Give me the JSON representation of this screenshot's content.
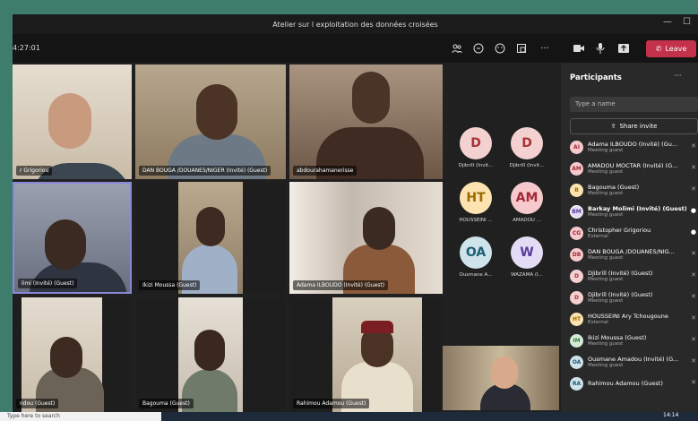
{
  "window": {
    "title": "Atelier sur l exploitation des données croisées",
    "minimize": "—",
    "maximize": "☐"
  },
  "toolbar": {
    "timer": "4:27:01",
    "leave_label": "Leave"
  },
  "tiles": {
    "t1": "r Grigoriou",
    "t2": "DAN BOUGA /DOUANES/NIGER (Invité) (Guest)",
    "t3": "abdourahamanerisse",
    "t4": "limi (Invité) (Guest)",
    "t5": "Ikizi Moussa (Guest)",
    "t6": "Adama ILBOUDO (Invité) (Guest)",
    "t7": "ndou (Guest)",
    "t8": "Bagouma (Guest)",
    "t9": "Rahimou Adamou (Guest)"
  },
  "avatars": [
    {
      "initials": "D",
      "label": "Djibrill (Invit...",
      "bg": "#f3d1d1",
      "fg": "#a33"
    },
    {
      "initials": "D",
      "label": "Djibrill (Invit...",
      "bg": "#f3d1d1",
      "fg": "#a33"
    },
    {
      "initials": "HT",
      "label": "HOUSSEINI ...",
      "bg": "#fce3b0",
      "fg": "#9a6b00"
    },
    {
      "initials": "AM",
      "label": "AMADOU ...",
      "bg": "#f6c9cc",
      "fg": "#a32838"
    },
    {
      "initials": "OA",
      "label": "Ousmane A...",
      "bg": "#cfe3ea",
      "fg": "#1f5d74"
    },
    {
      "initials": "W",
      "label": "WAZAMA (I...",
      "bg": "#e3dcf4",
      "fg": "#5a3a9e"
    }
  ],
  "panel": {
    "title": "Participants",
    "more": "···",
    "search_placeholder": "Type a name",
    "share_label": "Share invite"
  },
  "participants": [
    {
      "initials": "AI",
      "name": "Adama ILBOUDO (Invité) (Gu...",
      "role": "Meeting guest",
      "bg": "#f6c9cc",
      "fg": "#a32838"
    },
    {
      "initials": "AM",
      "name": "AMADOU MOCTAR (Invité) (G...",
      "role": "Meeting guest",
      "bg": "#f6c9cc",
      "fg": "#a32838"
    },
    {
      "initials": "B",
      "name": "Bagouma (Guest)",
      "role": "Meeting guest",
      "bg": "#fce3b0",
      "fg": "#9a6b00"
    },
    {
      "initials": "BM",
      "name": "Barkay Molimi (Invité) (Guest)",
      "role": "Meeting guest",
      "bg": "#e3dcf4",
      "fg": "#5a3a9e"
    },
    {
      "initials": "CG",
      "name": "Christopher Grigoriou",
      "role": "External",
      "bg": "#f6c9cc",
      "fg": "#a32838"
    },
    {
      "initials": "DB",
      "name": "DAN BOUGA /DOUANES/NIG...",
      "role": "Meeting guest",
      "bg": "#f6c9cc",
      "fg": "#a32838"
    },
    {
      "initials": "D",
      "name": "Djibrill (Invité) (Guest)",
      "role": "Meeting guest",
      "bg": "#f3d1d1",
      "fg": "#a33"
    },
    {
      "initials": "D",
      "name": "Djibrill (Invité) (Guest)",
      "role": "Meeting guest",
      "bg": "#f3d1d1",
      "fg": "#a33"
    },
    {
      "initials": "HT",
      "name": "HOUSSEINI Ary Tchougoune",
      "role": "External",
      "bg": "#fce3b0",
      "fg": "#9a6b00"
    },
    {
      "initials": "IM",
      "name": "Ikizi Moussa (Guest)",
      "role": "Meeting guest",
      "bg": "#d4ecd7",
      "fg": "#2f7a3e"
    },
    {
      "initials": "OA",
      "name": "Ousmane Amadou (Invité) (G...",
      "role": "Meeting guest",
      "bg": "#cfe3ea",
      "fg": "#1f5d74"
    },
    {
      "initials": "RA",
      "name": "Rahimou Adamou (Guest)",
      "role": "",
      "bg": "#cfe3ea",
      "fg": "#1f5d74"
    }
  ],
  "taskbar": {
    "search_placeholder": "Type here to search",
    "time": "14:14"
  }
}
